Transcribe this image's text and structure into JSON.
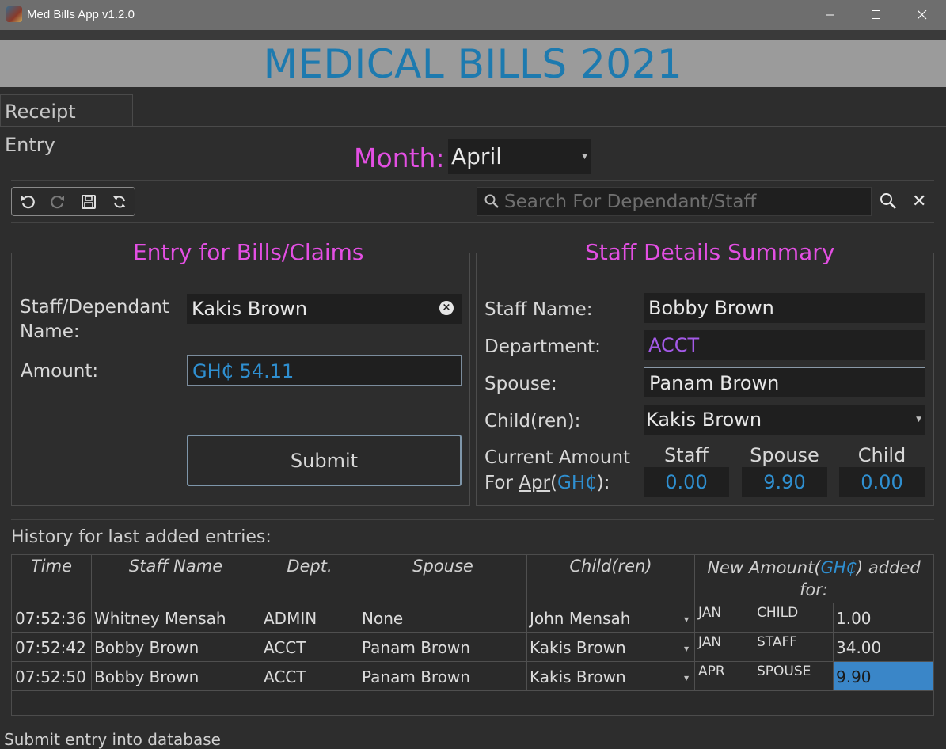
{
  "window": {
    "title": "Med Bills App v1.2.0"
  },
  "banner": {
    "title": "MEDICAL BILLS 2021"
  },
  "tabs": [
    {
      "label": "Receipt Entry"
    }
  ],
  "month": {
    "label": "Month:",
    "value": "April"
  },
  "search": {
    "placeholder": "Search For Dependant/Staff"
  },
  "entry": {
    "title": "Entry for Bills/Claims",
    "name_label_1": "Staff/Dependant",
    "name_label_2": "Name:",
    "name_value": "Kakis Brown",
    "amount_label": "Amount:",
    "amount_value": "GH₵ 54.11",
    "submit_label": "Submit"
  },
  "summary": {
    "title": "Staff Details Summary",
    "staff_name_label": "Staff Name:",
    "staff_name_value": "Bobby Brown",
    "department_label": "Department:",
    "department_value": "ACCT",
    "spouse_label": "Spouse:",
    "spouse_value": "Panam Brown",
    "children_label": "Child(ren):",
    "children_value": "Kakis Brown",
    "current_label_1": "Current Amount",
    "current_label_2_prefix": "For ",
    "current_label_2_month": "Apr",
    "current_label_2_open": "(",
    "current_label_2_currency": "GH₵",
    "current_label_2_close": "):",
    "col_staff": "Staff",
    "col_spouse": "Spouse",
    "col_child": "Child",
    "staff_amount": "0.00",
    "spouse_amount": "9.90",
    "child_amount": "0.00"
  },
  "history": {
    "label": "History for last added entries:",
    "headers": {
      "time": "Time",
      "staff_name": "Staff Name",
      "dept": "Dept.",
      "spouse": "Spouse",
      "children": "Child(ren)",
      "new_amount_1": "New Amount",
      "new_amount_open": "(",
      "new_amount_currency": "GH₵",
      "new_amount_close": ") added",
      "new_amount_2": "for:"
    },
    "rows": [
      {
        "time": "07:52:36",
        "staff": "Whitney Mensah",
        "dept": "ADMIN",
        "spouse": "None",
        "child": "John Mensah",
        "month": "JAN",
        "type": "CHILD",
        "amount": "1.00"
      },
      {
        "time": "07:52:42",
        "staff": "Bobby Brown",
        "dept": "ACCT",
        "spouse": "Panam Brown",
        "child": "Kakis Brown",
        "month": "JAN",
        "type": "STAFF",
        "amount": "34.00"
      },
      {
        "time": "07:52:50",
        "staff": "Bobby Brown",
        "dept": "ACCT",
        "spouse": "Panam Brown",
        "child": "Kakis Brown",
        "month": "APR",
        "type": "SPOUSE",
        "amount": "9.90"
      }
    ]
  },
  "status": {
    "text": "Submit entry into database"
  },
  "colors": {
    "accent_magenta": "#e34fe3",
    "accent_blue": "#1d7aaf",
    "value_blue": "#2f8fd0",
    "dept_purple": "#a45ae8"
  }
}
